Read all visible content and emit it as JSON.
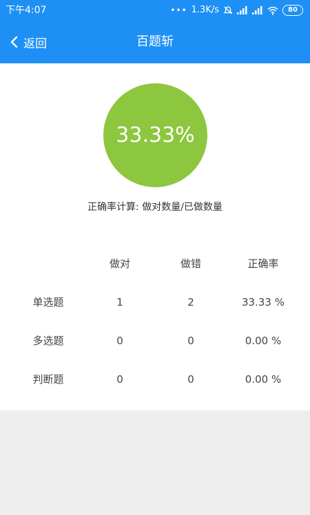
{
  "status_bar": {
    "time": "下午4:07",
    "network_speed": "1.3K/s",
    "battery": "80",
    "icons": [
      "signal-dots-icon",
      "mute-icon",
      "signal-icon",
      "signal-icon",
      "wifi-icon",
      "battery-icon"
    ]
  },
  "nav": {
    "back_label": "返回",
    "title": "百题斩",
    "back_icon": "chevron-left-icon"
  },
  "summary": {
    "accuracy": "33.33%",
    "accuracy_value": 33.33,
    "formula": "正确率计算: 做对数量/已做数量"
  },
  "colors": {
    "primary": "#1e90f5",
    "circle": "#8dc63f",
    "bottom_bg": "#eeeeee"
  },
  "table": {
    "headers": [
      "做对",
      "做错",
      "正确率"
    ],
    "rows": [
      {
        "label": "单选题",
        "correct": "1",
        "wrong": "2",
        "rate": "33.33 %"
      },
      {
        "label": "多选题",
        "correct": "0",
        "wrong": "0",
        "rate": "0.00 %"
      },
      {
        "label": "判断题",
        "correct": "0",
        "wrong": "0",
        "rate": "0.00 %"
      }
    ]
  }
}
